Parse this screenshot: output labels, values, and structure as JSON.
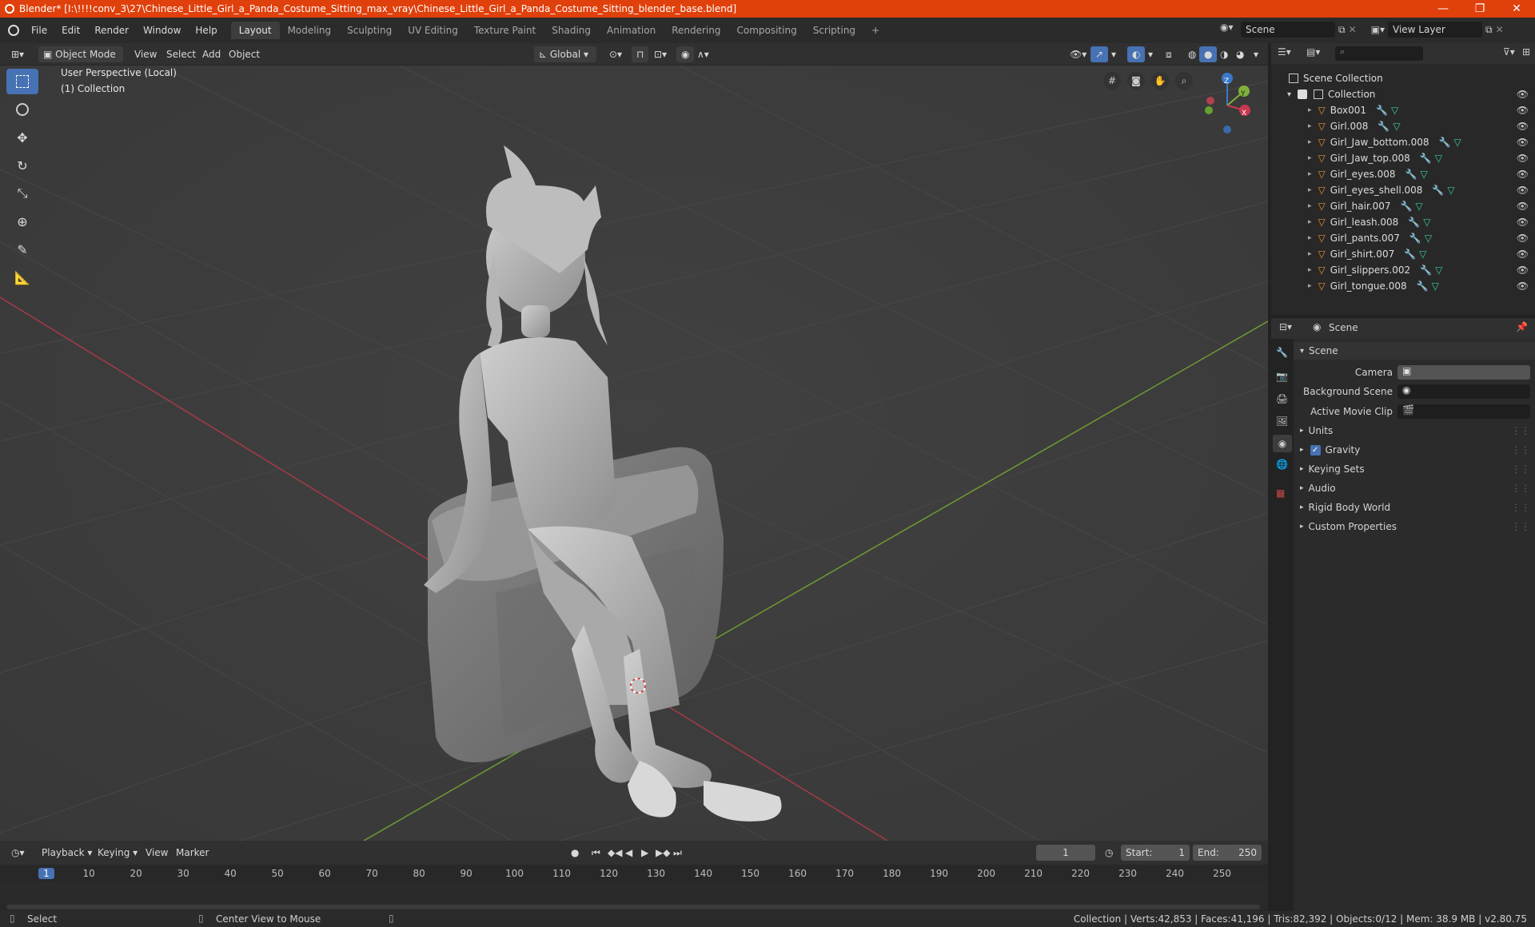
{
  "window": {
    "title": "Blender* [I:\\!!!!conv_3\\27\\Chinese_Little_Girl_a_Panda_Costume_Sitting_max_vray\\Chinese_Little_Girl_a_Panda_Costume_Sitting_blender_base.blend]",
    "minimize": "—",
    "maximize": "❐",
    "close": "✕"
  },
  "menubar": {
    "items": [
      "File",
      "Edit",
      "Render",
      "Window",
      "Help"
    ]
  },
  "workspaces": {
    "tabs": [
      "Layout",
      "Modeling",
      "Sculpting",
      "UV Editing",
      "Texture Paint",
      "Shading",
      "Animation",
      "Rendering",
      "Compositing",
      "Scripting"
    ],
    "active": "Layout",
    "add": "+"
  },
  "scene_selector": {
    "value": "Scene"
  },
  "view_layer_selector": {
    "value": "View Layer"
  },
  "viewport_header": {
    "mode": "Object Mode",
    "menus": [
      "View",
      "Select",
      "Add",
      "Object"
    ],
    "transform_orientation": "Global"
  },
  "viewport": {
    "perspective_label": "User Perspective (Local)",
    "collection_label": "(1) Collection",
    "gizmo": {
      "x": "X",
      "y": "Y",
      "z": "Z"
    }
  },
  "outliner": {
    "root": "Scene Collection",
    "collection": "Collection",
    "objects": [
      "Box001",
      "Girl.008",
      "Girl_Jaw_bottom.008",
      "Girl_Jaw_top.008",
      "Girl_eyes.008",
      "Girl_eyes_shell.008",
      "Girl_hair.007",
      "Girl_leash.008",
      "Girl_pants.007",
      "Girl_shirt.007",
      "Girl_slippers.002",
      "Girl_tongue.008"
    ]
  },
  "properties": {
    "context": "Scene",
    "panel_title": "Scene",
    "fields": {
      "camera_label": "Camera",
      "background_scene_label": "Background Scene",
      "active_movie_clip_label": "Active Movie Clip"
    },
    "subpanels": [
      "Units",
      "Gravity",
      "Keying Sets",
      "Audio",
      "Rigid Body World",
      "Custom Properties"
    ],
    "gravity_checked": true
  },
  "timeline": {
    "menus": [
      "Playback",
      "Keying",
      "View",
      "Marker"
    ],
    "current_frame": "1",
    "start_label": "Start:",
    "start": "1",
    "end_label": "End:",
    "end": "250",
    "ruler_ticks": [
      "1",
      "10",
      "20",
      "30",
      "40",
      "50",
      "60",
      "70",
      "80",
      "90",
      "100",
      "110",
      "120",
      "130",
      "140",
      "150",
      "160",
      "170",
      "180",
      "190",
      "200",
      "210",
      "220",
      "230",
      "240",
      "250"
    ]
  },
  "statusbar": {
    "left_action": "Select",
    "middle_action": "Center View to Mouse",
    "stats": "Collection | Verts:42,853 | Faces:41,196 | Tris:82,392 | Objects:0/12 | Mem: 38.9 MB | v2.80.75"
  },
  "colors": {
    "titlebar": "#e0400b",
    "accent": "#4772b3",
    "x_axis": "#c8384f",
    "y_axis": "#80b03a",
    "z_axis": "#3a79c8",
    "mesh_icon": "#e8902a",
    "modifier_icon": "#5a8ee8",
    "data_icon": "#3ad0a0"
  }
}
